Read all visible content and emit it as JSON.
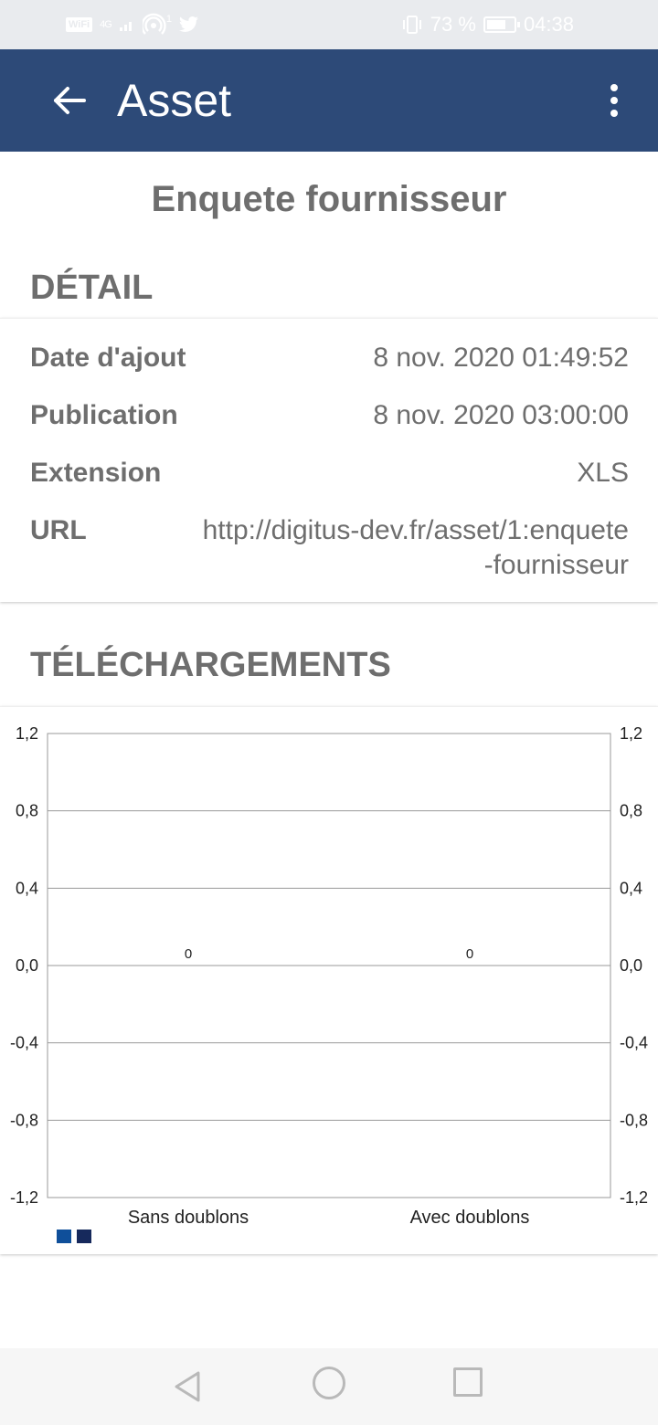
{
  "status_bar": {
    "wifi_badge": "WiFi",
    "network": "4G",
    "hotspot_count": "1",
    "battery_percent": "73 %",
    "battery_level": 0.73,
    "time": "04:38"
  },
  "app_bar": {
    "title": "Asset",
    "back_icon": "arrow-left-icon",
    "menu_icon": "more-vertical-icon"
  },
  "asset": {
    "title": "Enquete fournisseur"
  },
  "detail": {
    "section_title": "DÉTAIL",
    "rows": [
      {
        "label": "Date d'ajout",
        "value": "8 nov. 2020 01:49:52"
      },
      {
        "label": "Publication",
        "value": "8 nov. 2020 03:00:00"
      },
      {
        "label": "Extension",
        "value": "XLS"
      },
      {
        "label": "URL",
        "value": "http://digitus-dev.fr/asset/1:enquete-fournisseur",
        "value_line1": "http://digitus-dev.fr/asset/1:enquete",
        "value_line2": "-fournisseur"
      }
    ]
  },
  "downloads": {
    "section_title": "TÉLÉCHARGEMENTS"
  },
  "chart_data": {
    "type": "bar",
    "categories": [
      "Sans doublons",
      "Avec doublons"
    ],
    "series": [
      {
        "values": [
          0,
          0
        ],
        "color": "#0f4f9a"
      },
      {
        "values": [
          0,
          0
        ],
        "color": "#16295c"
      }
    ],
    "data_labels": [
      "0",
      "0"
    ],
    "ylim": [
      -1.2,
      1.2
    ],
    "yticks": [
      "1,2",
      "0,8",
      "0,4",
      "0,0",
      "-0,4",
      "-0,8",
      "-1,2"
    ],
    "ytick_values": [
      1.2,
      0.8,
      0.4,
      0.0,
      -0.4,
      -0.8,
      -1.2
    ],
    "y_axis_both_sides": true,
    "grid": true,
    "title": "",
    "xlabel": "",
    "ylabel": ""
  },
  "nav_bar": {
    "back_icon": "triangle-back-icon",
    "home_icon": "circle-home-icon",
    "recent_icon": "square-recents-icon"
  }
}
